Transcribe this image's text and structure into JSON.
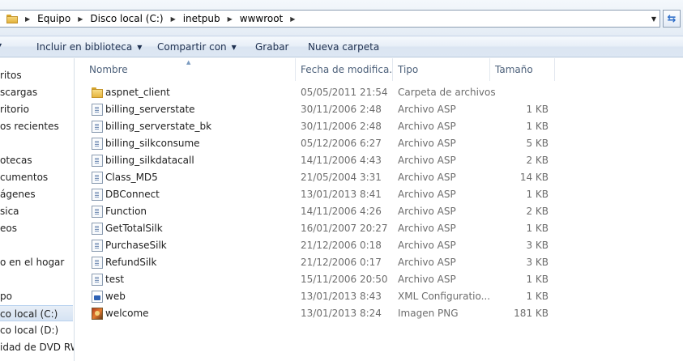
{
  "address_bar": {
    "crumbs": [
      "Equipo",
      "Disco local (C:)",
      "inetpub",
      "wwwroot"
    ]
  },
  "commands": {
    "include_library": "Incluir en biblioteca",
    "share_with": "Compartir con",
    "burn": "Grabar",
    "new_folder": "Nueva carpeta"
  },
  "columns": {
    "name": "Nombre",
    "date": "Fecha de modifica...",
    "type": "Tipo",
    "size": "Tamaño"
  },
  "nav": {
    "items": [
      "ritos",
      "scargas",
      "ritorio",
      "os recientes",
      "otecas",
      "cumentos",
      "ágenes",
      "sica",
      "eos",
      "o en el hogar",
      "po",
      "co local (C:)",
      "co local (D:)",
      "idad de DVD RW ("
    ],
    "selected_index": 11
  },
  "files": [
    {
      "name": "aspnet_client",
      "date": "05/05/2011 21:54",
      "type": "Carpeta de archivos",
      "size": "",
      "icon": "folder-icon"
    },
    {
      "name": "billing_serverstate",
      "date": "30/11/2006 2:48",
      "type": "Archivo ASP",
      "size": "1 KB",
      "icon": "asp-file-icon"
    },
    {
      "name": "billing_serverstate_bk",
      "date": "30/11/2006 2:48",
      "type": "Archivo ASP",
      "size": "1 KB",
      "icon": "asp-file-icon"
    },
    {
      "name": "billing_silkconsume",
      "date": "05/12/2006 6:27",
      "type": "Archivo ASP",
      "size": "5 KB",
      "icon": "asp-file-icon"
    },
    {
      "name": "billing_silkdatacall",
      "date": "14/11/2006 4:43",
      "type": "Archivo ASP",
      "size": "2 KB",
      "icon": "asp-file-icon"
    },
    {
      "name": "Class_MD5",
      "date": "21/05/2004 3:31",
      "type": "Archivo ASP",
      "size": "14 KB",
      "icon": "asp-file-icon"
    },
    {
      "name": "DBConnect",
      "date": "13/01/2013 8:41",
      "type": "Archivo ASP",
      "size": "1 KB",
      "icon": "asp-file-icon"
    },
    {
      "name": "Function",
      "date": "14/11/2006 4:26",
      "type": "Archivo ASP",
      "size": "2 KB",
      "icon": "asp-file-icon"
    },
    {
      "name": "GetTotalSilk",
      "date": "16/01/2007 20:27",
      "type": "Archivo ASP",
      "size": "1 KB",
      "icon": "asp-file-icon"
    },
    {
      "name": "PurchaseSilk",
      "date": "21/12/2006 0:18",
      "type": "Archivo ASP",
      "size": "3 KB",
      "icon": "asp-file-icon"
    },
    {
      "name": "RefundSilk",
      "date": "21/12/2006 0:17",
      "type": "Archivo ASP",
      "size": "3 KB",
      "icon": "asp-file-icon"
    },
    {
      "name": "test",
      "date": "15/11/2006 20:50",
      "type": "Archivo ASP",
      "size": "1 KB",
      "icon": "asp-file-icon"
    },
    {
      "name": "web",
      "date": "13/01/2013 8:43",
      "type": "XML Configuratio...",
      "size": "1 KB",
      "icon": "xml-config-icon"
    },
    {
      "name": "welcome",
      "date": "13/01/2013 8:24",
      "type": "Imagen PNG",
      "size": "181 KB",
      "icon": "png-image-icon"
    }
  ]
}
